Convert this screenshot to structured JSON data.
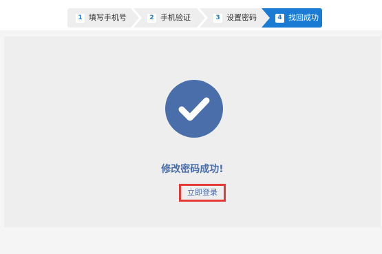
{
  "steps": [
    {
      "num": "1",
      "label": "填写手机号"
    },
    {
      "num": "2",
      "label": "手机验证"
    },
    {
      "num": "3",
      "label": "设置密码"
    },
    {
      "num": "4",
      "label": "找回成功"
    }
  ],
  "result": {
    "message": "修改密码成功!",
    "login_label": "立即登录"
  },
  "colors": {
    "active_step": "#1a7bd4",
    "check_circle": "#4a6ea9",
    "highlight_border": "#e53935"
  },
  "icons": {
    "success": "check-circle-icon"
  }
}
